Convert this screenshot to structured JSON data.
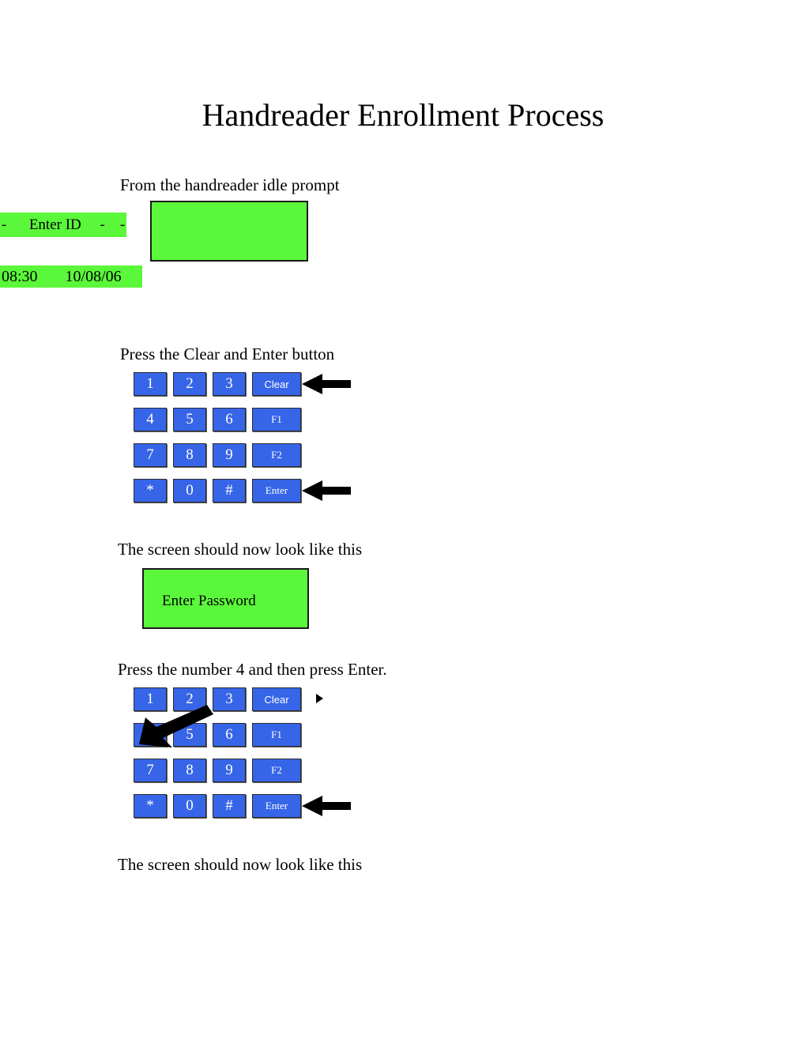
{
  "document": {
    "title": "Handreader Enrollment Process"
  },
  "steps": [
    {
      "caption": "From the handreader idle prompt"
    },
    {
      "caption": "Press the Clear and Enter button"
    },
    {
      "caption": "The screen should now look like this"
    },
    {
      "caption": "Press the number 4 and then press Enter."
    },
    {
      "caption": "The screen should now look like this"
    }
  ],
  "lcd": {
    "idle_prompt_line": "-      Enter ID     -    -",
    "idle_clock_line": "08:30       10/08/06",
    "blank_screen_text": "",
    "password_screen_text": "Enter Password",
    "background_color": "#5bf73a",
    "border_color": "#1a1a1a"
  },
  "keypad": {
    "button_color": "#3665e8",
    "label_color": "#ffffff",
    "rows": [
      [
        "1",
        "2",
        "3",
        "Clear"
      ],
      [
        "4",
        "5",
        "6",
        "F1"
      ],
      [
        "7",
        "8",
        "9",
        "F2"
      ],
      [
        "*",
        "0",
        "#",
        "Enter"
      ]
    ]
  },
  "annotations": {
    "arrow_color": "#000000",
    "step2_arrow_clear_target": "Clear",
    "step2_arrow_enter_target": "Enter",
    "step4_arrow_four_target": "4",
    "step4_arrow_enter_target": "Enter",
    "step4_marker": "right-triangle"
  }
}
